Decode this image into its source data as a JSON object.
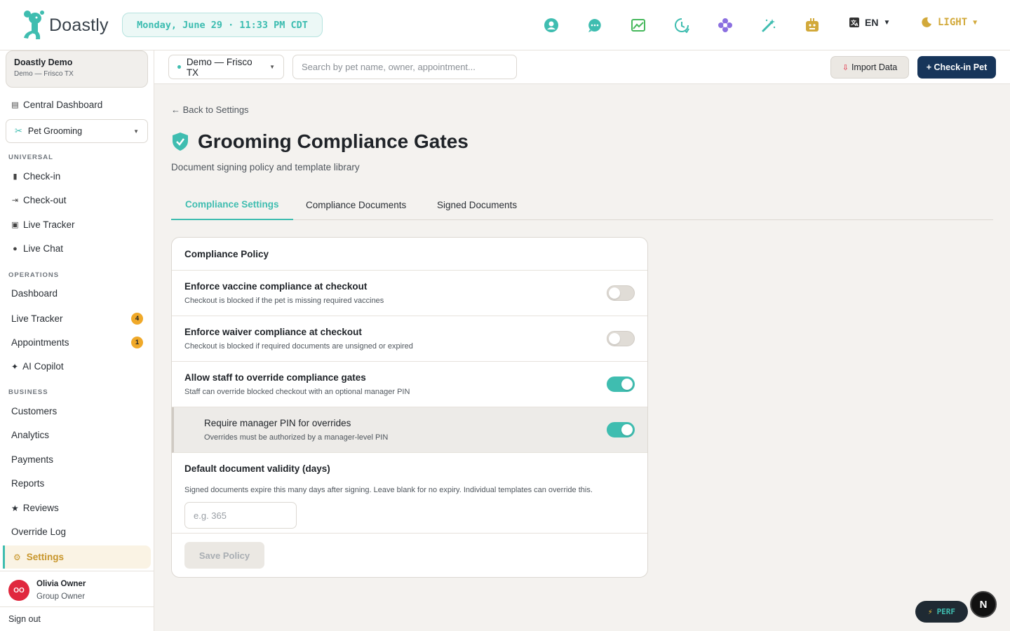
{
  "app": {
    "name": "Doastly",
    "datetime": "Monday, June 29 · 11:33 PM CDT",
    "language": "EN",
    "theme": "LIGHT"
  },
  "colors": {
    "accent": "#3fbdb0",
    "primary_button": "#17355a",
    "badge": "#f0a929",
    "active_nav_text": "#c8962c"
  },
  "top_icons": [
    "support-icon",
    "chat-icon",
    "chart-icon",
    "history-icon",
    "flower-icon",
    "magic-wand-icon",
    "robot-icon"
  ],
  "sidebar": {
    "org_name": "Doastly Demo",
    "org_location": "Demo — Frisco TX",
    "central_dashboard": "Central Dashboard",
    "module": "Pet Grooming",
    "sections": {
      "universal": "UNIVERSAL",
      "operations": "OPERATIONS",
      "business": "BUSINESS"
    },
    "universal_items": [
      "Check-in",
      "Check-out",
      "Live Tracker",
      "Live Chat"
    ],
    "operations_items": [
      {
        "label": "Dashboard",
        "badge": ""
      },
      {
        "label": "Live Tracker",
        "badge": "4"
      },
      {
        "label": "Appointments",
        "badge": "1"
      },
      {
        "label": "AI Copilot",
        "badge": ""
      }
    ],
    "business_items": [
      "Customers",
      "Analytics",
      "Payments",
      "Reports",
      "Reviews",
      "Override Log",
      "Settings"
    ],
    "user": {
      "initials": "OO",
      "name": "Olivia Owner",
      "role": "Group Owner"
    },
    "sign_out": "Sign out"
  },
  "subbar": {
    "location": "Demo — Frisco TX",
    "search_placeholder": "Search by pet name, owner, appointment...",
    "import_label": "Import Data",
    "checkin_label": "+ Check-in Pet"
  },
  "main": {
    "back_label": "← Back to Settings",
    "title": "Grooming Compliance Gates",
    "subtitle": "Document signing policy and template library",
    "tabs": [
      "Compliance Settings",
      "Compliance Documents",
      "Signed Documents"
    ],
    "card_title": "Compliance Policy",
    "settings": [
      {
        "title": "Enforce vaccine compliance at checkout",
        "desc": "Checkout is blocked if the pet is missing required vaccines",
        "enabled": false
      },
      {
        "title": "Enforce waiver compliance at checkout",
        "desc": "Checkout is blocked if required documents are unsigned or expired",
        "enabled": false
      },
      {
        "title": "Allow staff to override compliance gates",
        "desc": "Staff can override blocked checkout with an optional manager PIN",
        "enabled": true
      },
      {
        "title": "Require manager PIN for overrides",
        "desc": "Overrides must be authorized by a manager-level PIN",
        "enabled": true
      }
    ],
    "validity_title": "Default document validity (days)",
    "validity_desc": "Signed documents expire this many days after signing. Leave blank for no expiry. Individual templates can override this.",
    "validity_placeholder": "e.g. 365",
    "save_label": "Save Policy"
  },
  "dev": {
    "perf_label": "PERF",
    "n_label": "N"
  }
}
